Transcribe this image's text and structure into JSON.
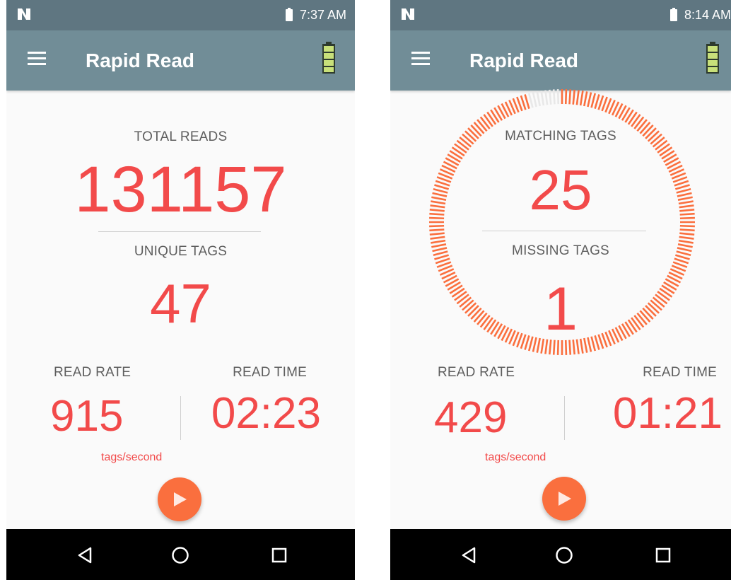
{
  "screens": [
    {
      "status": {
        "time": "7:37 AM"
      },
      "app_bar": {
        "title": "Rapid Read"
      },
      "metrics": {
        "primary_label": "TOTAL READS",
        "primary_value": "131157",
        "secondary_label": "UNIQUE TAGS",
        "secondary_value": "47"
      },
      "read_rate": {
        "label": "READ RATE",
        "value": "915",
        "unit": "tags/second"
      },
      "read_time": {
        "label": "READ TIME",
        "value": "02:23"
      },
      "play_button": {
        "icon": "play-icon"
      }
    },
    {
      "status": {
        "time": "8:14 AM"
      },
      "app_bar": {
        "title": "Rapid Read"
      },
      "metrics": {
        "primary_label": "MATCHING TAGS",
        "primary_value": "25",
        "secondary_label": "MISSING TAGS",
        "secondary_value": "1"
      },
      "progress_ring": {
        "fraction": 0.96,
        "color": "#fa6f3e",
        "track_color": "#e8e8e8"
      },
      "read_rate": {
        "label": "READ RATE",
        "value": "429",
        "unit": "tags/second"
      },
      "read_time": {
        "label": "READ TIME",
        "value": "01:21"
      },
      "play_button": {
        "icon": "play-icon"
      }
    }
  ],
  "colors": {
    "accent": "#f24a4a",
    "app_bar": "#718d97",
    "status_bar": "#5f7681",
    "fab": "#fa6f3e"
  }
}
